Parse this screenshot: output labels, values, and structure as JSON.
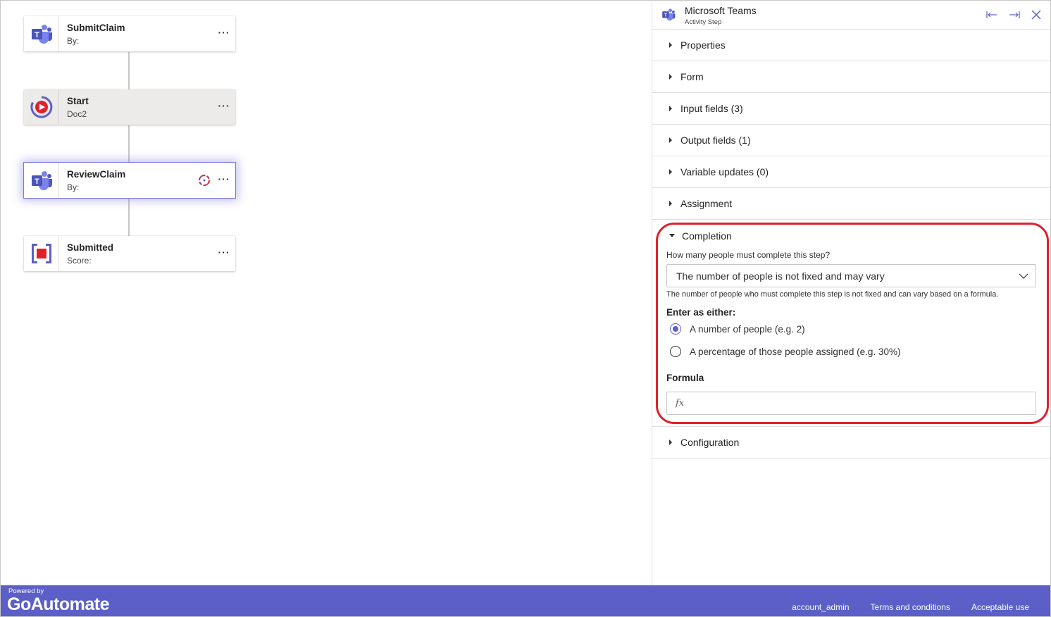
{
  "canvas": {
    "nodes": [
      {
        "title": "SubmitClaim",
        "subtitle": "By:",
        "icon": "teams-icon"
      },
      {
        "title": "Start",
        "subtitle": "Doc2",
        "icon": "start-icon"
      },
      {
        "title": "ReviewClaim",
        "subtitle": "By:",
        "icon": "teams-icon"
      },
      {
        "title": "Submitted",
        "subtitle": "Score:",
        "icon": "stop-icon"
      }
    ],
    "more_label": "···"
  },
  "panel": {
    "title": "Microsoft Teams",
    "subtitle": "Activity Step",
    "sections": {
      "properties": "Properties",
      "form": "Form",
      "input_fields": "Input fields (3)",
      "output_fields": "Output fields (1)",
      "variable_updates": "Variable updates (0)",
      "assignment": "Assignment",
      "completion": "Completion",
      "configuration": "Configuration"
    },
    "completion": {
      "question": "How many people must complete this step?",
      "dropdown_value": "The number of people is not fixed and may vary",
      "help_text": "The number of people who must complete this step is not fixed and can vary based on a formula.",
      "enter_label": "Enter as either:",
      "options": [
        {
          "label": "A number of people (e.g. 2)",
          "checked": true
        },
        {
          "label": "A percentage of those people assigned (e.g. 30%)",
          "checked": false
        }
      ],
      "formula_label": "Formula",
      "formula_value": "",
      "formula_icon": "fx"
    },
    "highlight_color": "#e0202b"
  },
  "footer": {
    "powered_by": "Powered by",
    "brand": "GoAutomate",
    "links": [
      "account_admin",
      "Terms and conditions",
      "Acceptable use"
    ],
    "background": "#5b5fc7"
  }
}
